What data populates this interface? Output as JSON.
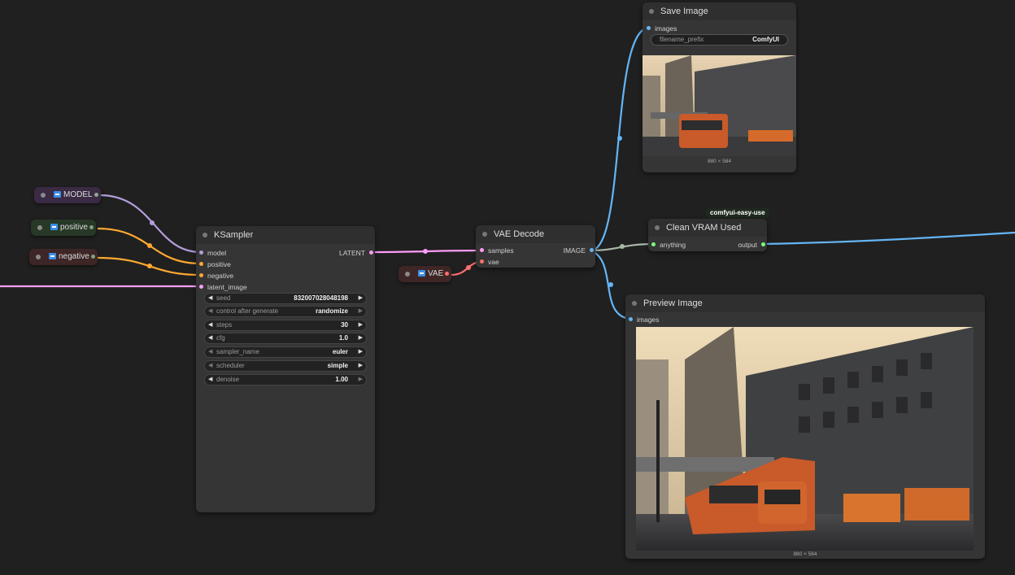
{
  "reroutes": {
    "model": "MODEL",
    "positive": "positive",
    "negative": "negative",
    "vae": "VAE"
  },
  "ksampler": {
    "title": "KSampler",
    "inputs": [
      "model",
      "positive",
      "negative",
      "latent_image"
    ],
    "output": "LATENT",
    "widgets": [
      {
        "label": "seed",
        "value": "832007028048198"
      },
      {
        "label": "control after generate",
        "value": "randomize"
      },
      {
        "label": "steps",
        "value": "30"
      },
      {
        "label": "cfg",
        "value": "1.0"
      },
      {
        "label": "sampler_name",
        "value": "euler"
      },
      {
        "label": "scheduler",
        "value": "simple"
      },
      {
        "label": "denoise",
        "value": "1.00"
      }
    ]
  },
  "vae_decode": {
    "title": "VAE Decode",
    "inputs": [
      "samples",
      "vae"
    ],
    "output": "IMAGE"
  },
  "save_image": {
    "title": "Save Image",
    "input": "images",
    "prefix_label": "filename_prefix",
    "prefix_value": "ComfyUI",
    "size": "880 × 584"
  },
  "clean_vram": {
    "title": "Clean VRAM Used",
    "tag": "comfyui-easy-use",
    "input": "anything",
    "output": "output"
  },
  "preview_image": {
    "title": "Preview Image",
    "input": "images",
    "size": "880 × 584"
  },
  "colors": {
    "background": "#202020",
    "node": "#353535",
    "model_wire": "#b39ddb",
    "conditioning_wire": "#ffa931",
    "latent_wire": "#ff9cf9",
    "image_wire": "#64b5f6",
    "vae_wire": "#ff6e6e",
    "any_wire": "#a8b8a8"
  }
}
